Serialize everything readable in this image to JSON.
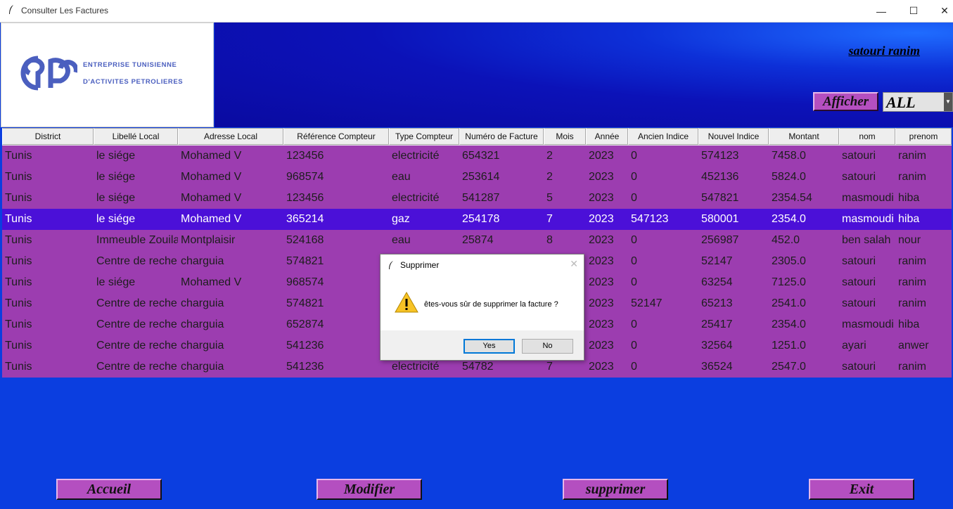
{
  "window": {
    "title": "Consulter Les Factures"
  },
  "logo": {
    "line1": "ENTREPRISE TUNISIENNE",
    "line2": "D'ACTIVITES PETROLIERES",
    "brand_color": "#4b5fbf"
  },
  "header": {
    "user_name": "satouri ranim",
    "afficher_label": "Afficher",
    "filter_value": "ALL"
  },
  "table": {
    "columns": [
      "District",
      "Libellé Local",
      "Adresse Local",
      "Référence Compteur",
      "Type Compteur",
      "Numéro de Facture",
      "Mois",
      "Année",
      "Ancien Indice",
      "Nouvel Indice",
      "Montant",
      "nom",
      "prenom"
    ],
    "rows": [
      [
        "Tunis",
        "le siége",
        "Mohamed V",
        "123456",
        "electricité",
        "654321",
        "2",
        "2023",
        "0",
        "574123",
        "7458.0",
        "satouri",
        "ranim"
      ],
      [
        "Tunis",
        "le siége",
        "Mohamed V",
        "968574",
        "eau",
        "253614",
        "2",
        "2023",
        "0",
        "452136",
        "5824.0",
        "satouri",
        "ranim"
      ],
      [
        "Tunis",
        "le siége",
        "Mohamed V",
        "123456",
        "electricité",
        "541287",
        "5",
        "2023",
        "0",
        "547821",
        "2354.54",
        "masmoudi",
        "hiba"
      ],
      [
        "Tunis",
        "le siége",
        "Mohamed V",
        "365214",
        "gaz",
        "254178",
        "7",
        "2023",
        "547123",
        "580001",
        "2354.0",
        "masmoudi",
        "hiba"
      ],
      [
        "Tunis",
        "Immeuble Zouila",
        "Montplaisir",
        "524168",
        "eau",
        "25874",
        "8",
        "2023",
        "0",
        "256987",
        "452.0",
        "ben salah",
        "nour"
      ],
      [
        "Tunis",
        "Centre de reche",
        "charguia",
        "574821",
        "",
        "",
        "",
        "2023",
        "0",
        "52147",
        "2305.0",
        "satouri",
        "ranim"
      ],
      [
        "Tunis",
        "le siége",
        "Mohamed V",
        "968574",
        "",
        "",
        "",
        "2023",
        "0",
        "63254",
        "7125.0",
        "satouri",
        "ranim"
      ],
      [
        "Tunis",
        "Centre de reche",
        "charguia",
        "574821",
        "",
        "",
        "",
        "2023",
        "52147",
        "65213",
        "2541.0",
        "satouri",
        "ranim"
      ],
      [
        "Tunis",
        "Centre de reche",
        "charguia",
        "652874",
        "",
        "",
        "",
        "2023",
        "0",
        "25417",
        "2354.0",
        "masmoudi",
        "hiba"
      ],
      [
        "Tunis",
        "Centre de reche",
        "charguia",
        "541236",
        "",
        "",
        "",
        "2023",
        "0",
        "32564",
        "1251.0",
        "ayari",
        "anwer"
      ],
      [
        "Tunis",
        "Centre de reche",
        "charguia",
        "541236",
        "electricité",
        "54782",
        "7",
        "2023",
        "0",
        "36524",
        "2547.0",
        "satouri",
        "ranim"
      ]
    ],
    "selected_row": 3,
    "row_color": "#9c3db0",
    "selected_color": "#4b10d8"
  },
  "dialog": {
    "title": "Supprimer",
    "message": "êtes-vous sûr de supprimer la facture ?",
    "yes_label": "Yes",
    "no_label": "No"
  },
  "footer": {
    "accueil_label": "Accueil",
    "modifier_label": "Modifier",
    "supprimer_label": "supprimer",
    "exit_label": "Exit"
  },
  "colors": {
    "background": "#0b3ee0",
    "button": "#b44fc0"
  }
}
